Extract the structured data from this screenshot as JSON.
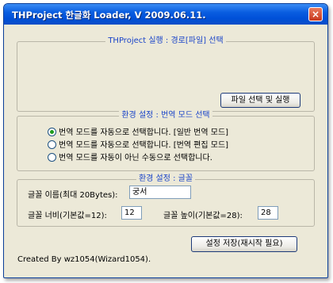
{
  "window": {
    "title": "THProject 한글화 Loader, V 2009.06.11.",
    "close_label": "×"
  },
  "execute_group": {
    "legend": "THProject 실행 : 경로[파일] 선택",
    "select_run_button": "파일 선택 및 실행"
  },
  "env_group": {
    "legend": "환경 설정 : 번역 모드 선택",
    "options": [
      "번역 모드를 자동으로 선택합니다. [일반 번역 모드]",
      "번역 모드를 자동으로 선택합니다. [번역 편집 모드]",
      "번역 모드를 자동이 아닌 수동으로 선택합니다."
    ],
    "selected_index": 0
  },
  "font_group": {
    "legend": "환경 설정 : 글꼴",
    "name_label": "글꼴 이름(최대 20Bytes):",
    "name_value": "궁서",
    "width_label": "글꼴 너비(기본값=12):",
    "width_value": "12",
    "height_label": "글꼴 높이(기본값=28):",
    "height_value": "28"
  },
  "save_button": "설정 저장(재시작 필요)",
  "footer": "Created By wz1054(Wizard1054)."
}
